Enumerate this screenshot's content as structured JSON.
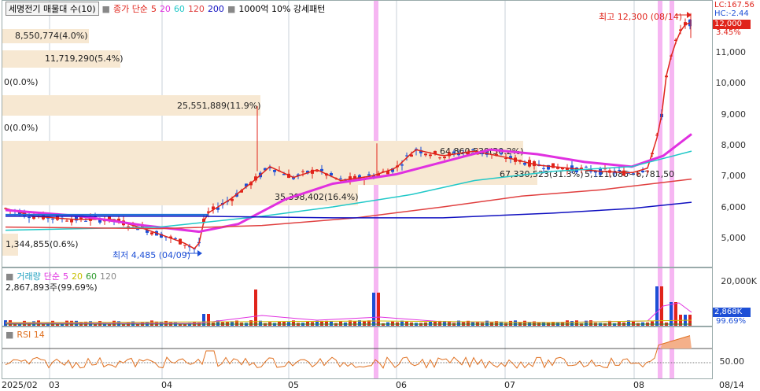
{
  "header": {
    "title": "세명전기 매물대 수(10)",
    "ma_label": "종가 단순",
    "ma_periods": [
      "5",
      "20",
      "60",
      "120",
      "200"
    ],
    "ma_colors": [
      "#e0241b",
      "#e030e0",
      "#20c8c8",
      "#e04040",
      "#1010c0"
    ],
    "extra": "1000억 10% 강세패턴"
  },
  "right_axis": {
    "lc": "LC:167.56",
    "hc": "HC:-2.44",
    "price_ticks": [
      "11,000",
      "10,000",
      "9,000",
      "8,000",
      "7,000",
      "6,000",
      "5,000"
    ],
    "current_price": "12,000",
    "current_pct": "3.45%",
    "volume_ticks": [
      "20,000K"
    ],
    "current_volume": "2,868K",
    "volume_pct": "99.69%",
    "rsi_ticks": [
      "50.00"
    ]
  },
  "annotations": {
    "high": "최고 12,300 (08/14)",
    "low": "최저 4,485 (04/09)"
  },
  "volume_profile": [
    {
      "label": "8,550,774(4.0%)",
      "frac": 0.12
    },
    {
      "label": "11,719,290(5.4%)",
      "frac": 0.165
    },
    {
      "label": "0(0.0%)",
      "frac": 0
    },
    {
      "label": "25,551,889(11.9%)",
      "frac": 0.36
    },
    {
      "label": "0(0.0%)",
      "frac": 0
    },
    {
      "label": "64,860,539(30.2%)",
      "frac": 0.735
    },
    {
      "label": "67,330,523(31.3%)",
      "frac": 0.76
    },
    {
      "label": "35,398,402(16.4%)",
      "frac": 0.5
    },
    {
      "label": "5,121,086~6,781,50",
      "frac": 0
    },
    {
      "label": "1,344,855(0.6%)",
      "frac": 0.02
    }
  ],
  "volume_pane": {
    "title": "거래량",
    "ma_label": "단순",
    "ma_periods": [
      "5",
      "20",
      "60",
      "120"
    ],
    "ma_colors": [
      "#e030e0",
      "#c8c000",
      "#2a9a2a",
      "#888888"
    ],
    "summary": "2,867,893주(99.69%)"
  },
  "rsi_pane": {
    "title": "RSI 14"
  },
  "x_axis": [
    "2025/02",
    "03",
    "04",
    "05",
    "06",
    "07",
    "08",
    "08/14"
  ],
  "colors": {
    "up": "#e0241b",
    "down": "#1d4fd6",
    "profile": "#f7e8d2",
    "highlight": "#f4a9f0"
  }
}
